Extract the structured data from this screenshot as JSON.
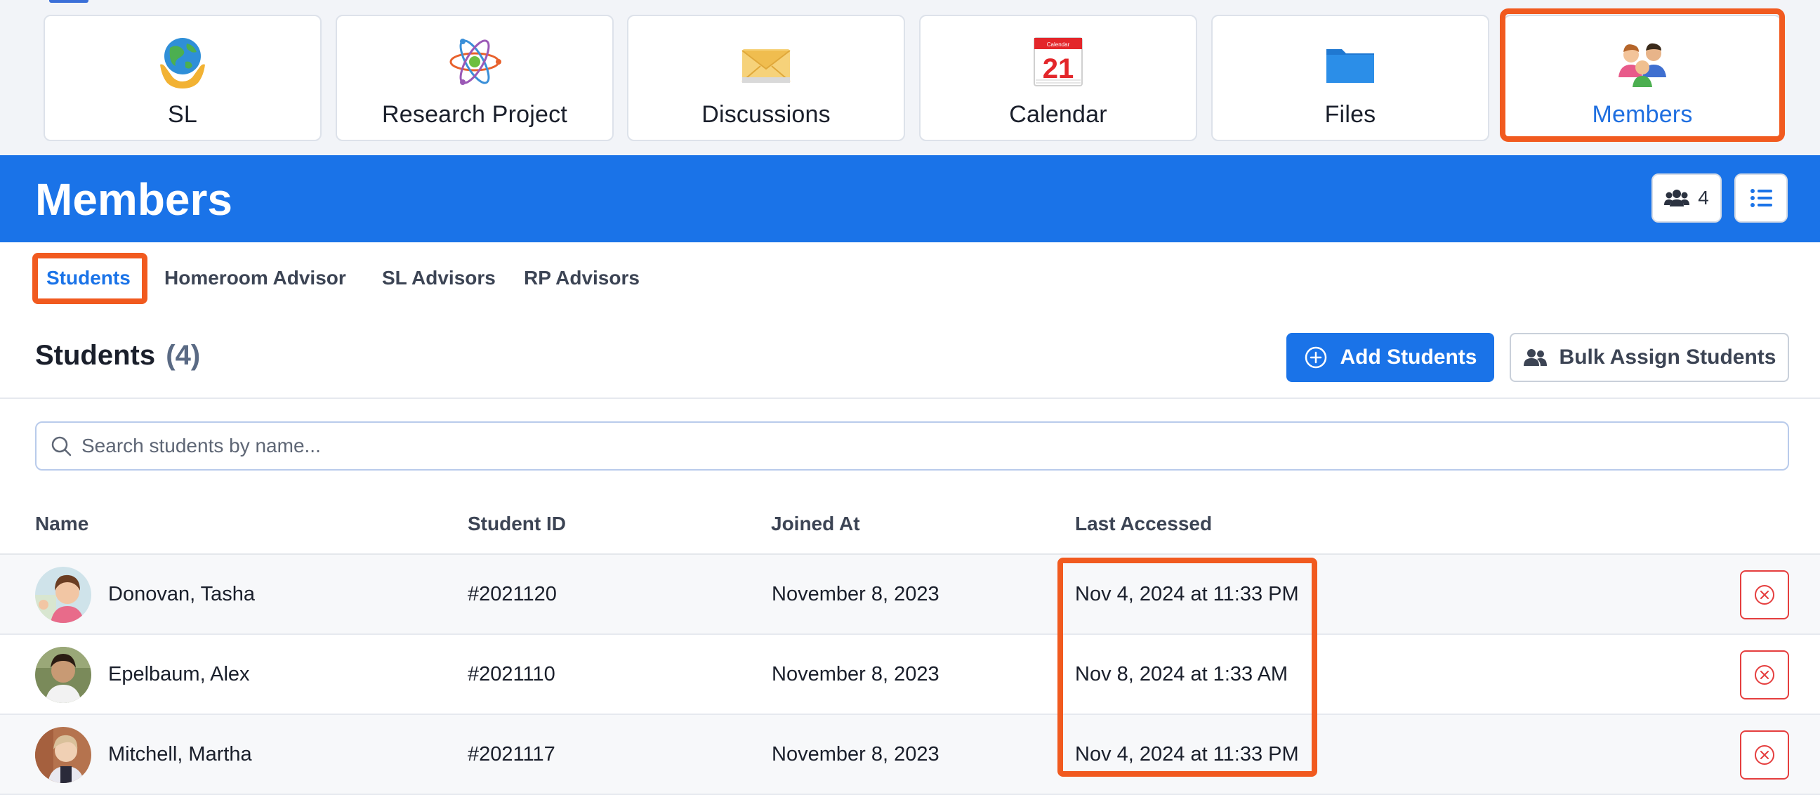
{
  "tiles": [
    {
      "label": "SL",
      "icon": "globe-hands-icon"
    },
    {
      "label": "Research Project",
      "icon": "atom-icon"
    },
    {
      "label": "Discussions",
      "icon": "envelope-icon"
    },
    {
      "label": "Calendar",
      "icon": "calendar-icon",
      "calendar_day": "21",
      "calendar_caption": "Calendar"
    },
    {
      "label": "Files",
      "icon": "folder-icon"
    },
    {
      "label": "Members",
      "icon": "people-icon",
      "active": true
    }
  ],
  "header": {
    "title": "Members",
    "member_count": "4",
    "accent": "#1a73e8"
  },
  "tabs": [
    {
      "label": "Students",
      "active": true
    },
    {
      "label": "Homeroom Advisor"
    },
    {
      "label": "SL Advisors"
    },
    {
      "label": "RP Advisors"
    }
  ],
  "section": {
    "title": "Students",
    "count": "(4)",
    "add_label": "Add Students",
    "bulk_label": "Bulk Assign Students"
  },
  "search": {
    "placeholder": "Search students by name..."
  },
  "table": {
    "columns": [
      "Name",
      "Student ID",
      "Joined At",
      "Last Accessed"
    ],
    "rows": [
      {
        "name": "Donovan, Tasha",
        "student_id": "#2021120",
        "joined_at": "November 8, 2023",
        "last_accessed": "Nov 4, 2024 at 11:33 PM"
      },
      {
        "name": "Epelbaum, Alex",
        "student_id": "#2021110",
        "joined_at": "November 8, 2023",
        "last_accessed": "Nov 8, 2024 at 1:33 AM"
      },
      {
        "name": "Mitchell, Martha",
        "student_id": "#2021117",
        "joined_at": "November 8, 2023",
        "last_accessed": "Nov 4, 2024 at 11:33 PM"
      }
    ]
  },
  "colors": {
    "highlight": "#f15a1f",
    "danger": "#e53e3e"
  }
}
